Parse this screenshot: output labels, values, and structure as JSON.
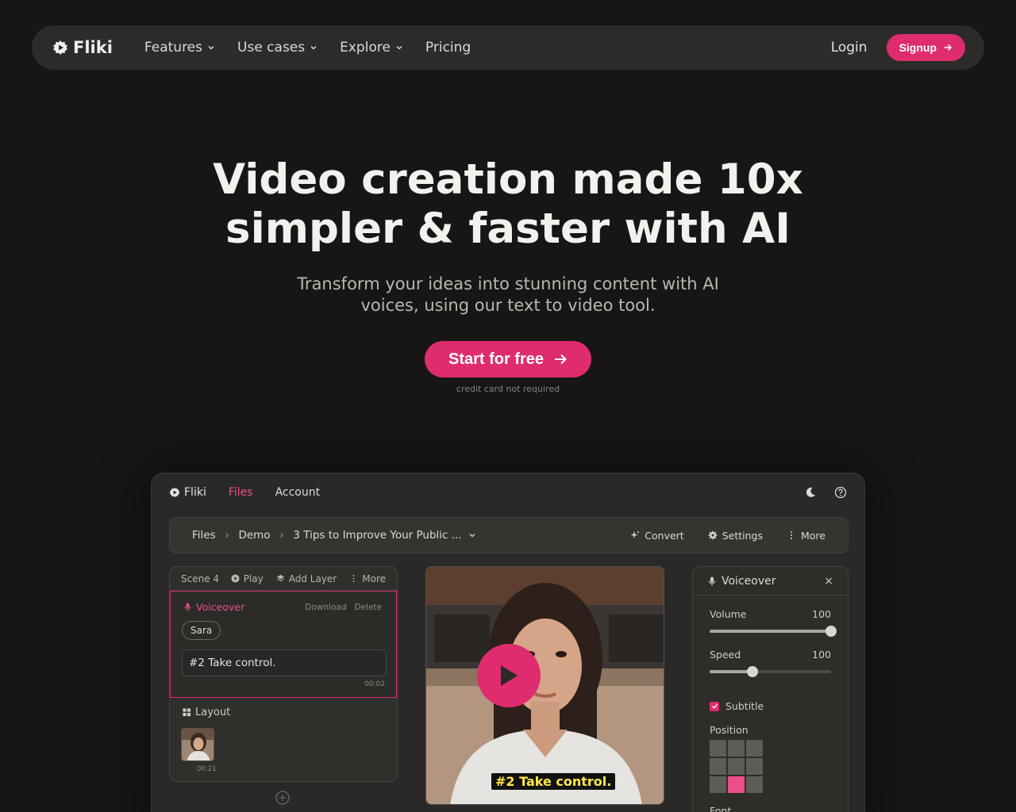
{
  "nav": {
    "brand": "Fliki",
    "links": [
      {
        "label": "Features",
        "dropdown": true
      },
      {
        "label": "Use cases",
        "dropdown": true
      },
      {
        "label": "Explore",
        "dropdown": true
      },
      {
        "label": "Pricing",
        "dropdown": false
      }
    ],
    "login": "Login",
    "signup": "Signup"
  },
  "hero": {
    "title_line1": "Video creation made 10x",
    "title_line2": "simpler & faster with AI",
    "subtitle_line1": "Transform your ideas into stunning content with AI",
    "subtitle_line2": "voices, using our text to video tool.",
    "cta": "Start for free",
    "cta_note": "credit card not required"
  },
  "app": {
    "brand": "Fliki",
    "tabs": [
      "Files",
      "Account"
    ],
    "active_tab": "Files",
    "breadcrumb": [
      "Files",
      "Demo",
      "3 Tips to Improve Your Public ..."
    ],
    "actions": [
      "Convert",
      "Settings",
      "More"
    ],
    "scene": {
      "title": "Scene 4",
      "actions": [
        "Play",
        "Add Layer",
        "More"
      ],
      "voiceover_label": "Voiceover",
      "download": "Download",
      "delete": "Delete",
      "voice": "Sara",
      "text": "#2 Take control.",
      "time": "00:02",
      "layout_label": "Layout",
      "layout_time": "00:21"
    },
    "video": {
      "caption": "#2 Take control."
    },
    "voiceover_panel": {
      "title": "Voiceover",
      "close": "×",
      "volume_label": "Volume",
      "volume": "100",
      "volume_fraction": 1.0,
      "speed_label": "Speed",
      "speed": "100",
      "speed_fraction": 0.35,
      "subtitle_label": "Subtitle",
      "subtitle_checked": true,
      "position_label": "Position",
      "position_selected": 7,
      "font_label": "Font"
    }
  },
  "colors": {
    "accent": "#de2c6e",
    "background": "#171614",
    "caption": "#ffe74a"
  }
}
